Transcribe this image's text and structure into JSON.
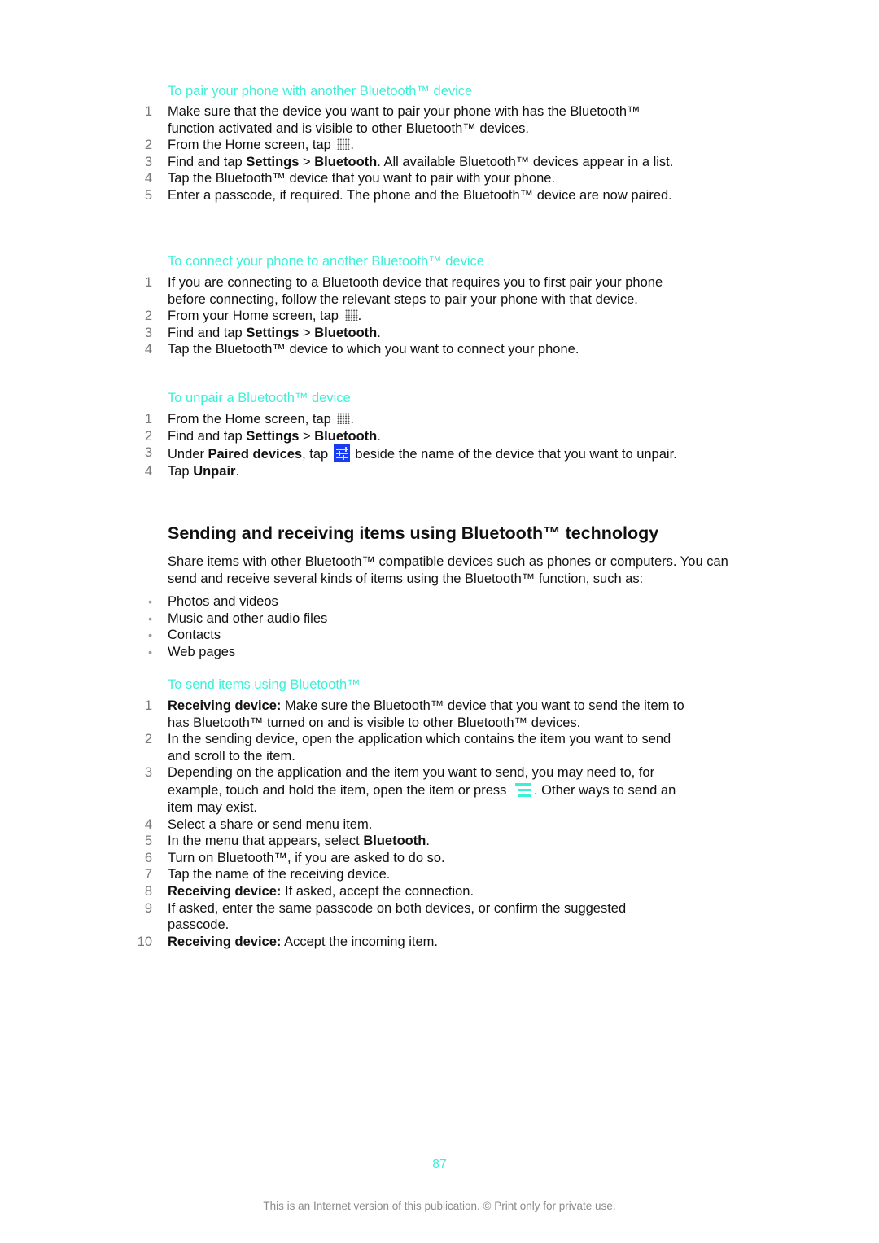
{
  "sections": [
    {
      "title": "To pair your phone with another Bluetooth™ device",
      "steps": [
        {
          "num": "1",
          "parts": [
            {
              "t": "Make sure that the device you want to pair your phone with has the Bluetooth™ function activated and is visible to other Bluetooth™ devices."
            }
          ]
        },
        {
          "num": "2",
          "parts": [
            {
              "t": "From the Home screen, tap "
            },
            {
              "icon": "apps-grid-icon"
            },
            {
              "t": "."
            }
          ]
        },
        {
          "num": "3",
          "parts": [
            {
              "t": "Find and tap "
            },
            {
              "b": "Settings"
            },
            {
              "t": " > "
            },
            {
              "b": "Bluetooth"
            },
            {
              "t": ". All available Bluetooth™ devices appear in a list."
            }
          ]
        },
        {
          "num": "4",
          "parts": [
            {
              "t": "Tap the Bluetooth™ device that you want to pair with your phone."
            }
          ]
        },
        {
          "num": "5",
          "parts": [
            {
              "t": "Enter a passcode, if required. The phone and the Bluetooth™ device are now paired."
            }
          ]
        }
      ]
    },
    {
      "title": "To connect your phone to another Bluetooth™ device",
      "steps": [
        {
          "num": "1",
          "parts": [
            {
              "t": "If you are connecting to a Bluetooth device that requires you to first pair your phone before connecting, follow the relevant steps to pair your phone with that device."
            }
          ]
        },
        {
          "num": "2",
          "parts": [
            {
              "t": "From your Home screen, tap "
            },
            {
              "icon": "apps-grid-icon"
            },
            {
              "t": "."
            }
          ]
        },
        {
          "num": "3",
          "parts": [
            {
              "t": "Find and tap "
            },
            {
              "b": "Settings"
            },
            {
              "t": " > "
            },
            {
              "b": "Bluetooth"
            },
            {
              "t": "."
            }
          ]
        },
        {
          "num": "4",
          "parts": [
            {
              "t": "Tap the Bluetooth™ device to which you want to connect your phone."
            }
          ]
        }
      ]
    },
    {
      "title": "To unpair a Bluetooth™ device",
      "steps": [
        {
          "num": "1",
          "parts": [
            {
              "t": "From the Home screen, tap "
            },
            {
              "icon": "apps-grid-icon"
            },
            {
              "t": "."
            }
          ]
        },
        {
          "num": "2",
          "parts": [
            {
              "t": "Find and tap "
            },
            {
              "b": "Settings"
            },
            {
              "t": " > "
            },
            {
              "b": "Bluetooth"
            },
            {
              "t": "."
            }
          ]
        },
        {
          "num": "3",
          "parts": [
            {
              "t": "Under "
            },
            {
              "b": "Paired devices"
            },
            {
              "t": ", tap "
            },
            {
              "icon": "device-settings-icon"
            },
            {
              "t": " beside the name of the device that you want to unpair."
            }
          ]
        },
        {
          "num": "4",
          "parts": [
            {
              "t": "Tap "
            },
            {
              "b": "Unpair"
            },
            {
              "t": "."
            }
          ]
        }
      ]
    }
  ],
  "main_heading": "Sending and receiving items using Bluetooth™ technology",
  "intro": "Share items with other Bluetooth™ compatible devices such as phones or computers. You can send and receive several kinds of items using the Bluetooth™ function, such as:",
  "bullet_symbol": "•",
  "bullets": [
    "Photos and videos",
    "Music and other audio files",
    "Contacts",
    "Web pages"
  ],
  "send_section": {
    "title": "To send items using Bluetooth™",
    "steps": [
      {
        "num": "1",
        "parts": [
          {
            "b": "Receiving device:"
          },
          {
            "t": " Make sure the Bluetooth™ device that you want to send the item to has Bluetooth™ turned on and is visible to other Bluetooth™ devices."
          }
        ]
      },
      {
        "num": "2",
        "parts": [
          {
            "t": "In the sending device, open the application which contains the item you want to send and scroll to the item."
          }
        ]
      },
      {
        "num": "3",
        "parts": [
          {
            "t": "Depending on the application and the item you want to send, you may need to, for example, touch and hold the item, open the item or press "
          },
          {
            "icon": "menu-icon"
          },
          {
            "t": ". Other ways to send an item may exist."
          }
        ]
      },
      {
        "num": "4",
        "parts": [
          {
            "t": "Select a share or send menu item."
          }
        ]
      },
      {
        "num": "5",
        "parts": [
          {
            "t": "In the menu that appears, select "
          },
          {
            "b": "Bluetooth"
          },
          {
            "t": "."
          }
        ]
      },
      {
        "num": "6",
        "parts": [
          {
            "t": "Turn on Bluetooth™, if you are asked to do so."
          }
        ]
      },
      {
        "num": "7",
        "parts": [
          {
            "t": "Tap the name of the receiving device."
          }
        ]
      },
      {
        "num": "8",
        "parts": [
          {
            "b": "Receiving device:"
          },
          {
            "t": " If asked, accept the connection."
          }
        ]
      },
      {
        "num": "9",
        "parts": [
          {
            "t": "If asked, enter the same passcode on both devices, or confirm the suggested passcode."
          }
        ]
      },
      {
        "num": "10",
        "parts": [
          {
            "b": "Receiving device:"
          },
          {
            "t": " Accept the incoming item."
          }
        ]
      }
    ]
  },
  "page_number": "87",
  "footer": "This is an Internet version of this publication. © Print only for private use.",
  "colors": {
    "accent": "#3cf0d8",
    "step_number": "#7a7a7a",
    "icon_blue": "#1a3cf0"
  }
}
